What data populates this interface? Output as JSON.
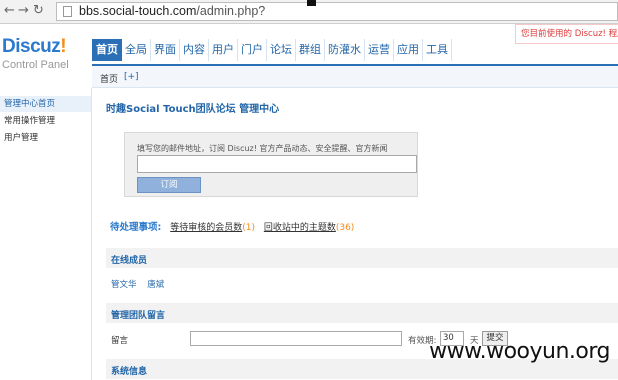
{
  "browser": {
    "back_icon": "back-arrow-icon",
    "forward_icon": "forward-arrow-icon",
    "reload_icon": "reload-icon",
    "url_host": "bbs.social-touch.com",
    "url_path": "/admin.php?"
  },
  "header": {
    "logo_main": "Discuz",
    "logo_bang": "!",
    "logo_sub": "Control Panel",
    "notice": "您目前使用的 Discuz! 程序",
    "nav": [
      "首页",
      "全局",
      "界面",
      "内容",
      "用户",
      "门户",
      "论坛",
      "群组",
      "防灌水",
      "运营",
      "应用",
      "工具"
    ]
  },
  "subbar": {
    "crumb": "首页",
    "plus": "[+]"
  },
  "sidebar": {
    "items": [
      "管理中心首页",
      "常用操作管理",
      "用户管理"
    ]
  },
  "main": {
    "title": "时趣Social Touch团队论坛 管理中心",
    "subscribe": {
      "label": "填写您的邮件地址，订阅 Discuz! 官方产品动态、安全提醒、官方新闻",
      "button": "订阅"
    },
    "todo": {
      "title": "待处理事项:",
      "items": [
        {
          "label": "等待审核的会员数",
          "count": "(1)"
        },
        {
          "label": "回收站中的主题数",
          "count": "(36)"
        }
      ]
    },
    "online": {
      "title": "在线成员",
      "members": [
        "管文华",
        "唐斌"
      ]
    },
    "team_msg": {
      "title": "管理团队留言",
      "label": "留言",
      "validity_label": "有效期:",
      "days_value": "30",
      "days_unit": "天",
      "submit": "提交"
    },
    "system_info": {
      "title": "系统信息"
    }
  },
  "watermark": "www.wooyun.org",
  "colors": {
    "accent": "#2b6fb6",
    "link": "#2366a8",
    "logo_blue": "#2b7acd",
    "logo_orange": "#f28c1a",
    "notice_red": "#e03a3a"
  }
}
